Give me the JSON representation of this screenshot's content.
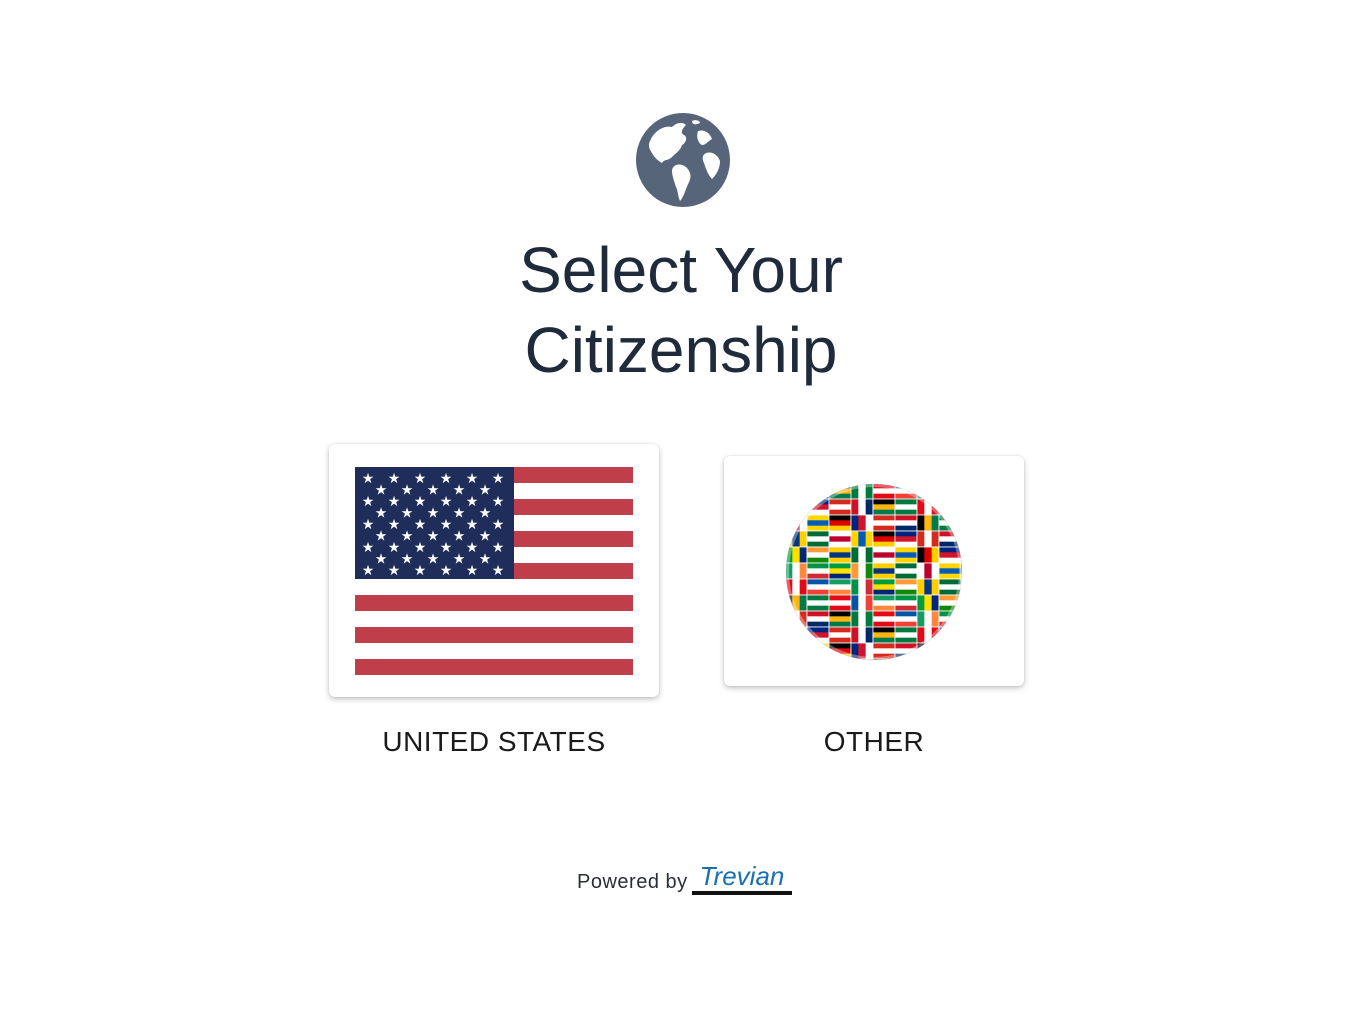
{
  "header": {
    "icon": "globe-icon",
    "title_line1": "Select Your",
    "title_line2": "Citizenship"
  },
  "options": [
    {
      "label": "UNITED STATES",
      "image": "us-flag"
    },
    {
      "label": "OTHER",
      "image": "world-flags-globe"
    }
  ],
  "footer": {
    "powered_by": "Powered by",
    "brand": "Trevian"
  },
  "colors": {
    "title": "#1f2b3a",
    "globe_icon": "#56657a",
    "us_blue": "#1f2d5a",
    "us_red": "#bf3e4a",
    "brand_blue": "#1a6fb0"
  }
}
